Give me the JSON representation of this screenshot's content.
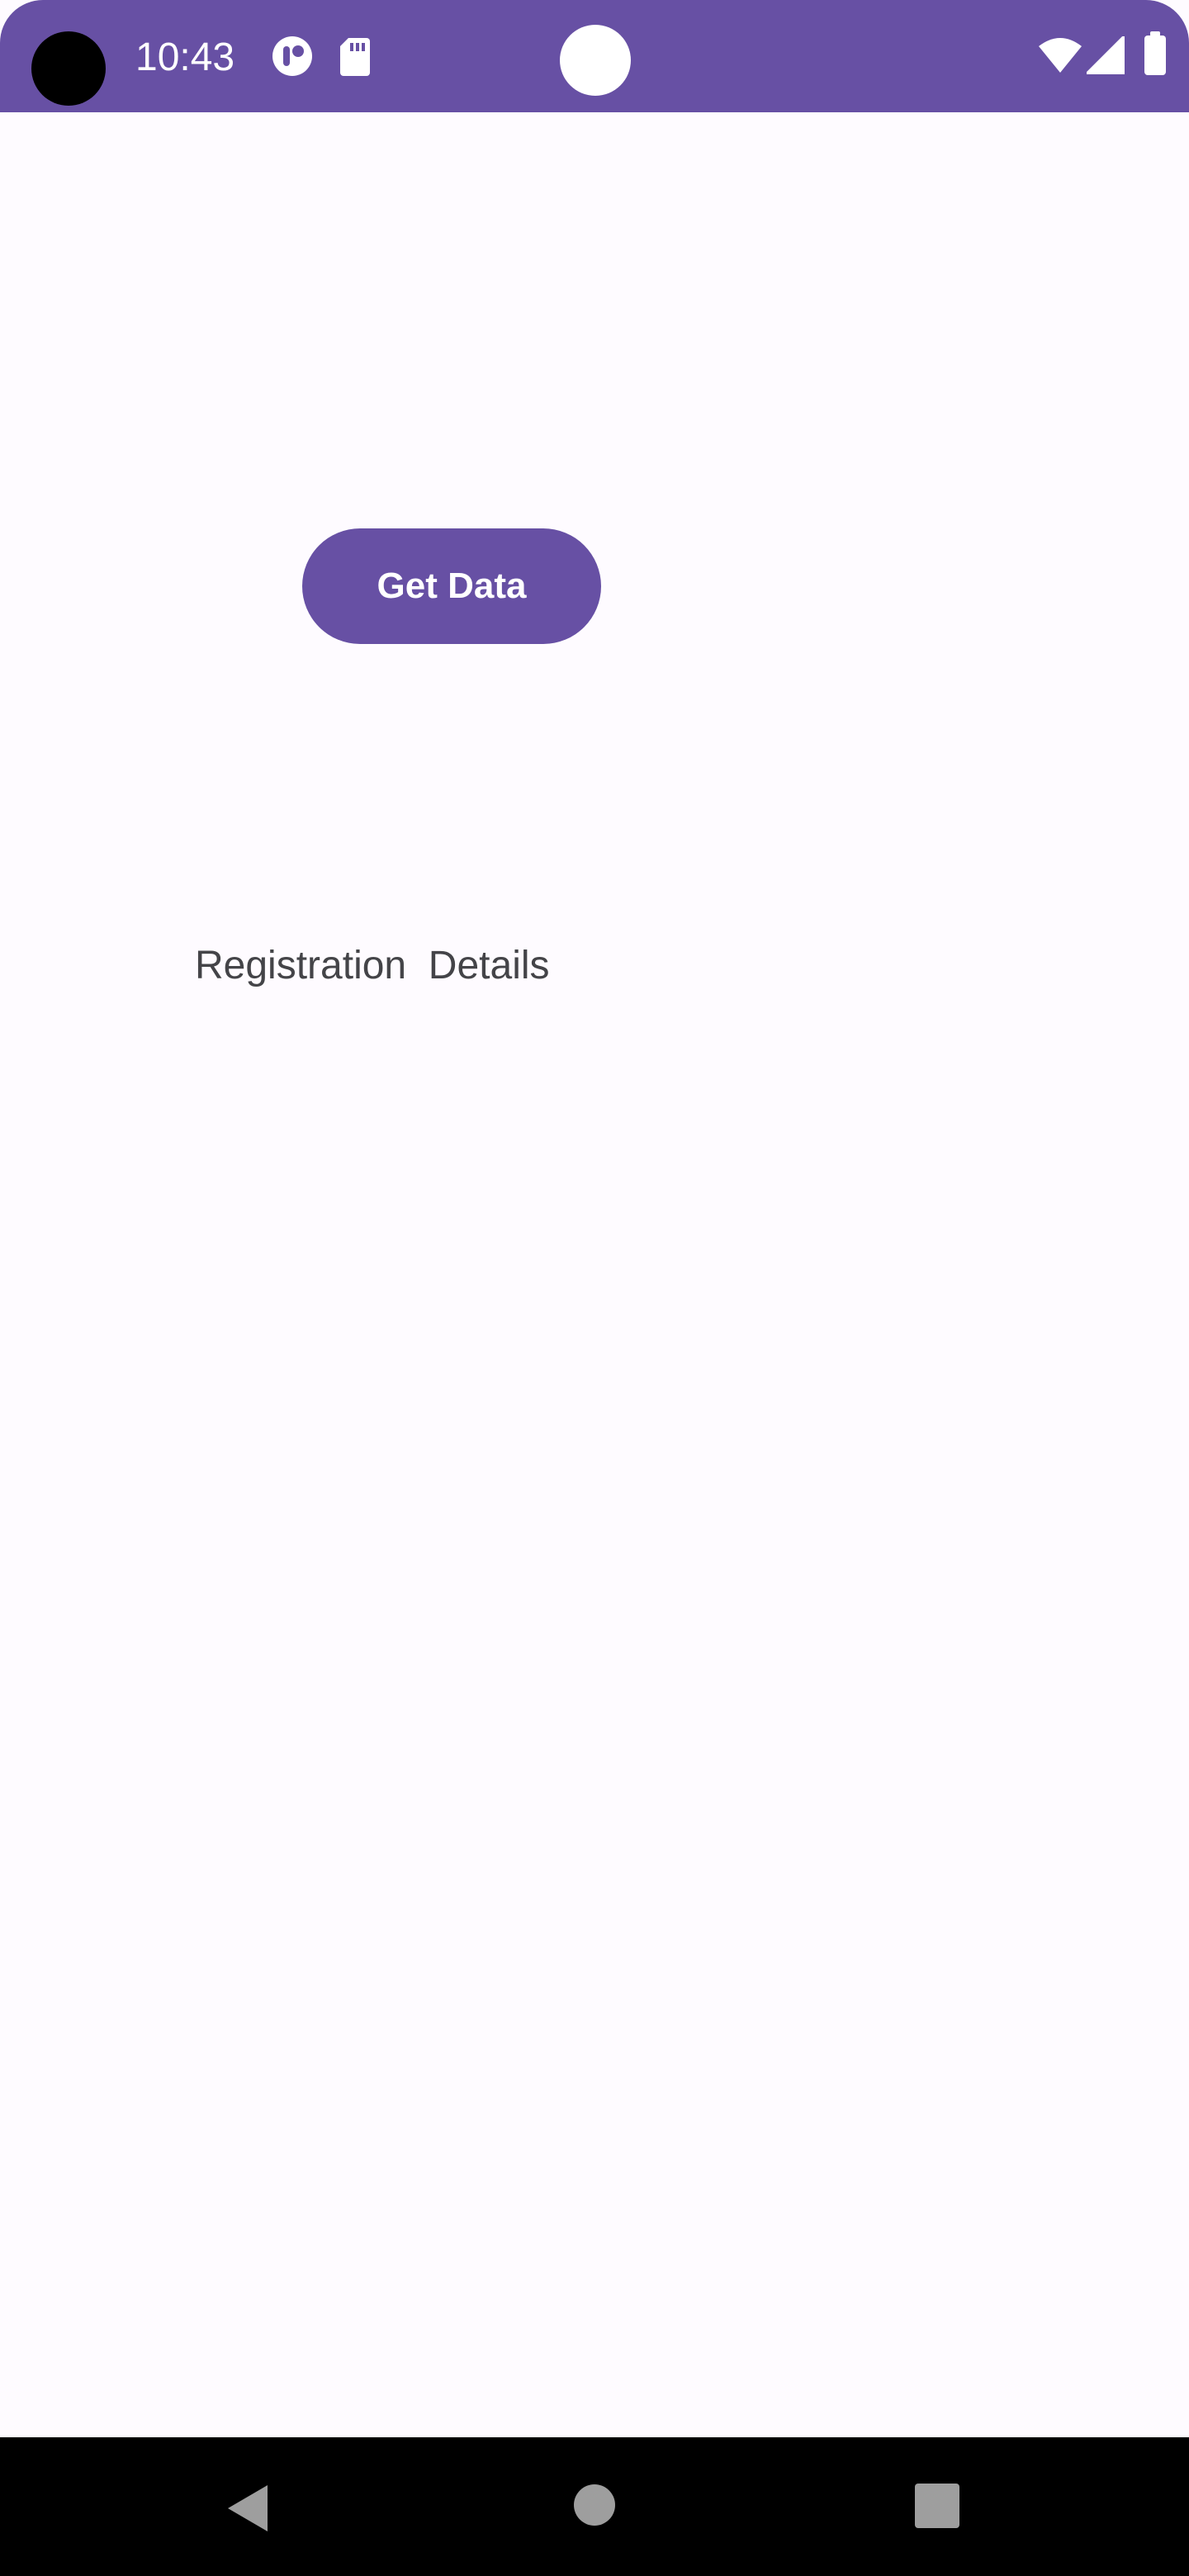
{
  "status_bar": {
    "time": "10:43",
    "color": "#6750a4",
    "icons": [
      "camera-cutout",
      "app-notification-icon",
      "sd-card-icon",
      "wifi-icon",
      "cellular-signal-icon",
      "battery-icon"
    ]
  },
  "main": {
    "get_data_label": "Get Data",
    "registration_label": "Registration  Details"
  },
  "nav_bar": {
    "buttons": [
      "back-icon",
      "home-icon",
      "recents-icon"
    ]
  },
  "colors": {
    "primary": "#6750a4",
    "background": "#fefbff",
    "text": "#444448"
  }
}
